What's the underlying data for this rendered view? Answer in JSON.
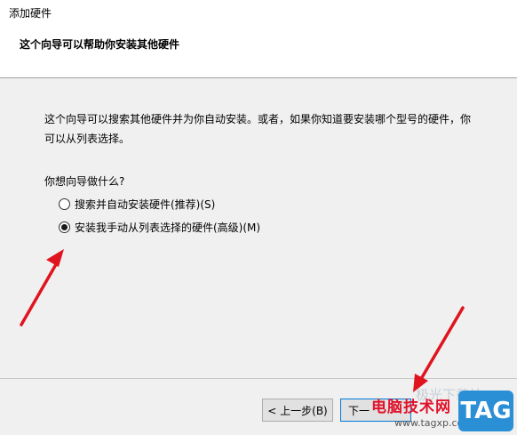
{
  "window": {
    "title": "添加硬件"
  },
  "header": {
    "heading": "这个向导可以帮助你安装其他硬件"
  },
  "content": {
    "description_line1": "这个向导可以搜索其他硬件并为你自动安装。或者，如果你知道要安装哪个型号的硬件，你",
    "description_line2": "可以从列表选择。",
    "question": "你想向导做什么?",
    "options": [
      {
        "label": "搜索并自动安装硬件(推荐)(S)",
        "checked": false
      },
      {
        "label": "安装我手动从列表选择的硬件(高级)(M)",
        "checked": true
      }
    ]
  },
  "footer": {
    "back_label": "< 上一步(B)",
    "next_label": "下一"
  },
  "watermark": {
    "site_name": "电脑技术网",
    "url": "www.tagxp.com",
    "tag": "TAG"
  },
  "annotation_color": "#e0141e"
}
